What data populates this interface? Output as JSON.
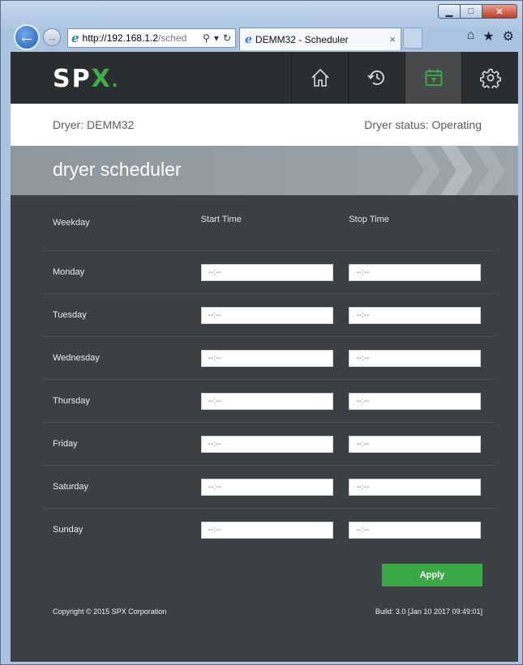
{
  "browser": {
    "url_host": "http://192.168.1.2",
    "url_path": "/sched",
    "tab_title": "DEMM32 - Scheduler",
    "tab_close": "×"
  },
  "app": {
    "logo_main": "SP",
    "logo_x": "X",
    "logo_dot": ".",
    "nav": [
      "home-icon",
      "history-icon",
      "calendar-icon",
      "settings-icon"
    ],
    "active_nav": "calendar-icon",
    "accent_color": "#3fae49"
  },
  "status": {
    "dryer": "Dryer: DEMM32",
    "dryer_status": "Dryer status: Operating"
  },
  "page": {
    "title": "dryer scheduler"
  },
  "schedule": {
    "headers": {
      "weekday": "Weekday",
      "start": "Start Time",
      "stop": "Stop Time"
    },
    "rows": [
      {
        "day": "Monday",
        "start": "--:--",
        "stop": "--:--"
      },
      {
        "day": "Tuesday",
        "start": "--:--",
        "stop": "--:--"
      },
      {
        "day": "Wednesday",
        "start": "--:--",
        "stop": "--:--"
      },
      {
        "day": "Thursday",
        "start": "--:--",
        "stop": "--:--"
      },
      {
        "day": "Friday",
        "start": "--:--",
        "stop": "--:--"
      },
      {
        "day": "Saturday",
        "start": "--:--",
        "stop": "--:--"
      },
      {
        "day": "Sunday",
        "start": "--:--",
        "stop": "--:--"
      }
    ],
    "apply_label": "Apply"
  },
  "footer": {
    "copyright": "Copyright © 2015 SPX Corporation",
    "build": "Build: 3.0 [Jan 10 2017 09:49:01]"
  }
}
